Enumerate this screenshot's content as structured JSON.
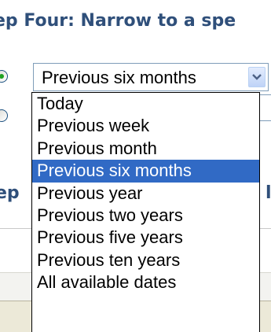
{
  "step_heading": "ep Four: Narrow to a spe",
  "step_heading_hidden_left": "ep",
  "step_heading_hidden_right": "l",
  "date_select": {
    "value": "Previous six months",
    "options": [
      "Today",
      "Previous week",
      "Previous month",
      "Previous six months",
      "Previous year",
      "Previous two years",
      "Previous five years",
      "Previous ten years",
      "All available dates"
    ],
    "selected_index": 3
  },
  "colors": {
    "heading": "#2f4f7a",
    "selection": "#316ac5",
    "radio_dot": "#21a121"
  }
}
